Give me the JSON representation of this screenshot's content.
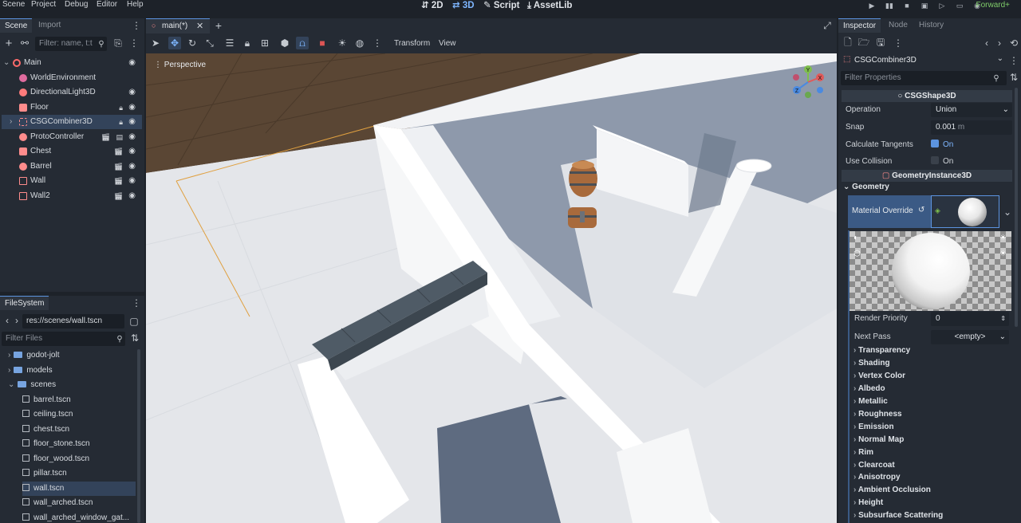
{
  "menu": [
    "Scene",
    "Project",
    "Debug",
    "Editor",
    "Help"
  ],
  "workspaces": [
    {
      "label": "2D",
      "icon": "2d-icon"
    },
    {
      "label": "3D",
      "icon": "3d-icon"
    },
    {
      "label": "Script",
      "icon": "script-icon"
    },
    {
      "label": "AssetLib",
      "icon": "assetlib-icon"
    }
  ],
  "renderer": "Forward+",
  "scene_dock": {
    "tabs": [
      "Scene",
      "Import"
    ],
    "filter_placeholder": "Filter: name, t:t",
    "tree": [
      {
        "label": "Main",
        "icon": "node3d-icon",
        "color": "#ff6b6b"
      },
      {
        "label": "WorldEnvironment",
        "icon": "world-environment-icon",
        "color": "#ff8c8c"
      },
      {
        "label": "DirectionalLight3D",
        "icon": "light-icon",
        "color": "#ff8c8c"
      },
      {
        "label": "Floor",
        "icon": "csg-icon",
        "color": "#ff8c8c"
      },
      {
        "label": "CSGCombiner3D",
        "icon": "csg-combiner-icon",
        "color": "#ff8c8c"
      },
      {
        "label": "ProtoController",
        "icon": "character-icon",
        "color": "#ff8c8c"
      },
      {
        "label": "Chest",
        "icon": "scene-icon",
        "color": "#ff8c8c"
      },
      {
        "label": "Barrel",
        "icon": "scene-icon",
        "color": "#ff8c8c"
      },
      {
        "label": "Wall",
        "icon": "scene-icon",
        "color": "#ff8c8c"
      },
      {
        "label": "Wall2",
        "icon": "scene-icon",
        "color": "#ff8c8c"
      }
    ]
  },
  "filesystem": {
    "tab": "FileSystem",
    "path": "res://scenes/wall.tscn",
    "filter_placeholder": "Filter Files",
    "items": [
      {
        "label": "godot-jolt",
        "type": "folder"
      },
      {
        "label": "models",
        "type": "folder"
      },
      {
        "label": "scenes",
        "type": "folder"
      },
      {
        "label": "barrel.tscn",
        "type": "file"
      },
      {
        "label": "ceiling.tscn",
        "type": "file"
      },
      {
        "label": "chest.tscn",
        "type": "file"
      },
      {
        "label": "floor_stone.tscn",
        "type": "file"
      },
      {
        "label": "floor_wood.tscn",
        "type": "file"
      },
      {
        "label": "pillar.tscn",
        "type": "file"
      },
      {
        "label": "wall.tscn",
        "type": "file"
      },
      {
        "label": "wall_arched.tscn",
        "type": "file"
      },
      {
        "label": "wall_arched_window_gat...",
        "type": "file"
      }
    ]
  },
  "editor_tab": "main(*)",
  "toolbar": {
    "transform": "Transform",
    "view": "View"
  },
  "viewport": {
    "mode": "Perspective"
  },
  "gizmo": {
    "y": "Y",
    "x": "X",
    "z": "Z"
  },
  "inspector": {
    "tabs": [
      "Inspector",
      "Node",
      "History"
    ],
    "object": "CSGCombiner3D",
    "filter_placeholder": "Filter Properties",
    "section_csg": "CSGShape3D",
    "operation_label": "Operation",
    "operation_value": "Union",
    "snap_label": "Snap",
    "snap_value": "0.001",
    "snap_unit": "m",
    "tangents_label": "Calculate Tangents",
    "tangents_value": "On",
    "collision_label": "Use Collision",
    "collision_value": "On",
    "section_geometry": "GeometryInstance3D",
    "geometry_label": "Geometry",
    "material_override_label": "Material Override",
    "render_priority_label": "Render Priority",
    "render_priority_value": "0",
    "next_pass_label": "Next Pass",
    "next_pass_value": "<empty>",
    "groups": [
      "Transparency",
      "Shading",
      "Vertex Color",
      "Albedo",
      "Metallic",
      "Roughness",
      "Emission",
      "Normal Map",
      "Rim",
      "Clearcoat",
      "Anisotropy",
      "Ambient Occlusion",
      "Height",
      "Subsurface Scattering"
    ]
  }
}
